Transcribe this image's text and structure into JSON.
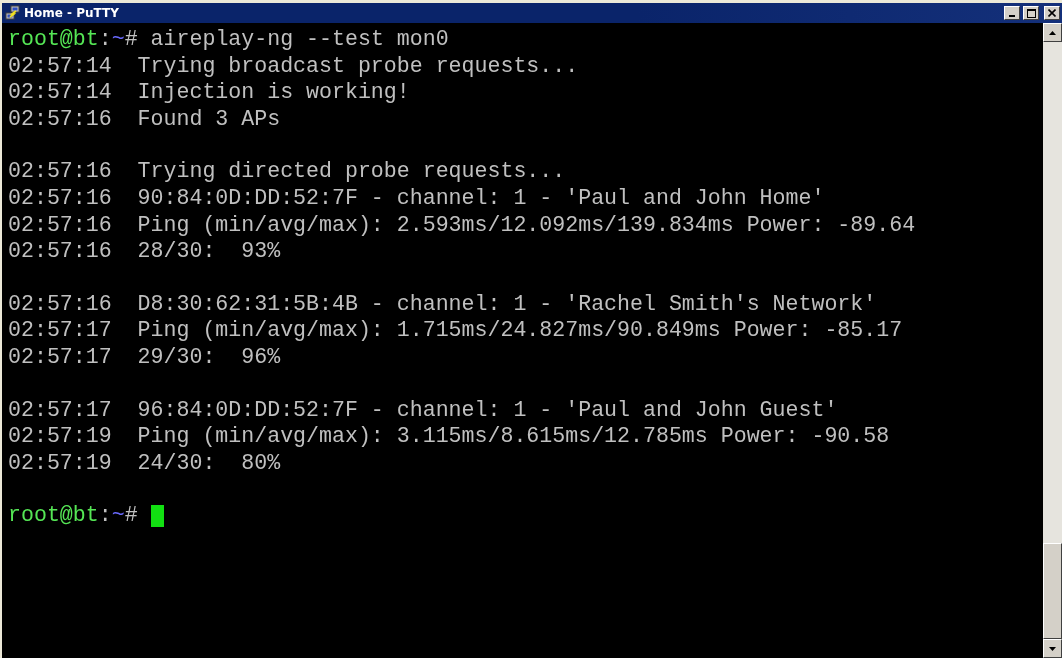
{
  "window": {
    "title": "Home - PuTTY"
  },
  "terminal": {
    "blocks": [
      [
        {
          "kind": "prompt",
          "user_host": "root@bt",
          "separator": ":",
          "path": "~",
          "symbol": "#",
          "command": "aireplay-ng --test mon0",
          "cursor": false
        },
        {
          "kind": "output",
          "text": "02:57:14  Trying broadcast probe requests..."
        },
        {
          "kind": "output",
          "text": "02:57:14  Injection is working!"
        },
        {
          "kind": "output",
          "text": "02:57:16  Found 3 APs"
        }
      ],
      [
        {
          "kind": "output",
          "text": "02:57:16  Trying directed probe requests..."
        },
        {
          "kind": "output",
          "text": "02:57:16  90:84:0D:DD:52:7F - channel: 1 - 'Paul and John Home'"
        },
        {
          "kind": "output",
          "text": "02:57:16  Ping (min/avg/max): 2.593ms/12.092ms/139.834ms Power: -89.64"
        },
        {
          "kind": "output",
          "text": "02:57:16  28/30:  93%"
        }
      ],
      [
        {
          "kind": "output",
          "text": "02:57:16  D8:30:62:31:5B:4B - channel: 1 - 'Rachel Smith's Network'"
        },
        {
          "kind": "output",
          "text": "02:57:17  Ping (min/avg/max): 1.715ms/24.827ms/90.849ms Power: -85.17"
        },
        {
          "kind": "output",
          "text": "02:57:17  29/30:  96%"
        }
      ],
      [
        {
          "kind": "output",
          "text": "02:57:17  96:84:0D:DD:52:7F - channel: 1 - 'Paul and John Guest'"
        },
        {
          "kind": "output",
          "text": "02:57:19  Ping (min/avg/max): 3.115ms/8.615ms/12.785ms Power: -90.58"
        },
        {
          "kind": "output",
          "text": "02:57:19  24/30:  80%"
        }
      ],
      [
        {
          "kind": "prompt",
          "user_host": "root@bt",
          "separator": ":",
          "path": "~",
          "symbol": "#",
          "cursor": true
        }
      ]
    ]
  }
}
